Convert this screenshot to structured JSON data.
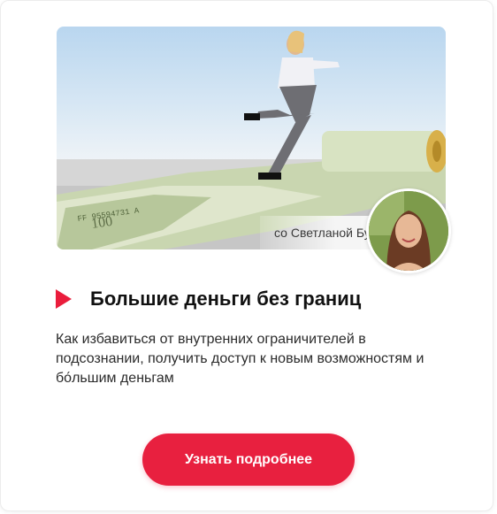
{
  "hero": {
    "image": "woman-running-on-dollar-carpet-image",
    "caption": "со Светланой Бугелой"
  },
  "avatar": {
    "image": "presenter-portrait"
  },
  "course": {
    "title": "Большие деньги без границ",
    "description": "Как избавиться от внутренних ограничителей в подсознании, получить доступ к новым возможностям и бо́льшим деньгам"
  },
  "cta": {
    "label": "Узнать подробнее"
  },
  "colors": {
    "accent": "#e8203f",
    "title": "#111111",
    "text": "#2b2b2b"
  }
}
